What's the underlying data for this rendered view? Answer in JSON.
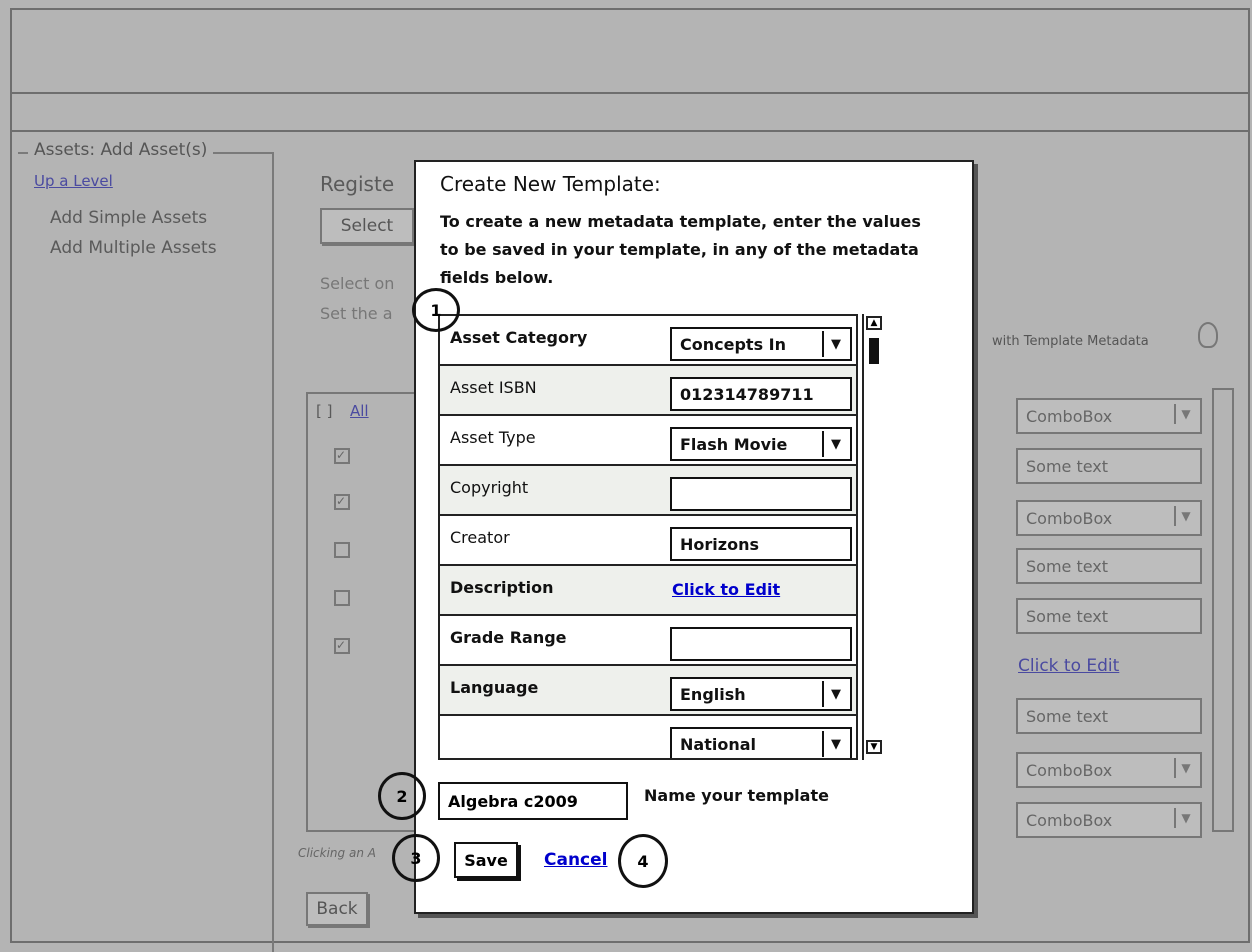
{
  "sidebar": {
    "title": "Assets: Add Asset(s)",
    "up_link": "Up a Level",
    "items": [
      "Add Simple Assets",
      "Add Multiple Assets"
    ]
  },
  "background": {
    "heading": "Registe",
    "select_button": "Select",
    "line1": "Select on",
    "line2": "Set the a",
    "template_metadata": "with Template Metadata",
    "all_checkbox": "[ ]",
    "all_link": "All",
    "footnote": "Clicking an A",
    "back_button": "Back",
    "right_fields": [
      "ComboBox",
      "Some text",
      "ComboBox",
      "Some text",
      "Some text",
      "Click to Edit",
      "Some text",
      "ComboBox",
      "ComboBox"
    ],
    "checks": [
      true,
      true,
      false,
      false,
      true
    ]
  },
  "modal": {
    "title": "Create New Template:",
    "description": "To create a new metadata template, enter the values to be saved in your template, in any of the metadata fields below.",
    "rows": [
      {
        "label": "Asset Category",
        "value": "Concepts In",
        "type": "combo"
      },
      {
        "label": "Asset ISBN",
        "value": "012314789711",
        "type": "text"
      },
      {
        "label": "Asset Type",
        "value": "Flash Movie",
        "type": "combo"
      },
      {
        "label": "Copyright",
        "value": "",
        "type": "text"
      },
      {
        "label": "Creator",
        "value": "Horizons",
        "type": "text"
      },
      {
        "label": "Description",
        "value": "Click to Edit",
        "type": "link"
      },
      {
        "label": "Grade Range",
        "value": "",
        "type": "text"
      },
      {
        "label": "Language",
        "value": "English",
        "type": "combo"
      },
      {
        "label": "",
        "value": "National",
        "type": "combo"
      }
    ],
    "template_name_value": "Algebra c2009",
    "template_name_label": "Name your template",
    "save": "Save",
    "cancel": "Cancel",
    "callouts": [
      "1",
      "2",
      "3",
      "4"
    ]
  }
}
